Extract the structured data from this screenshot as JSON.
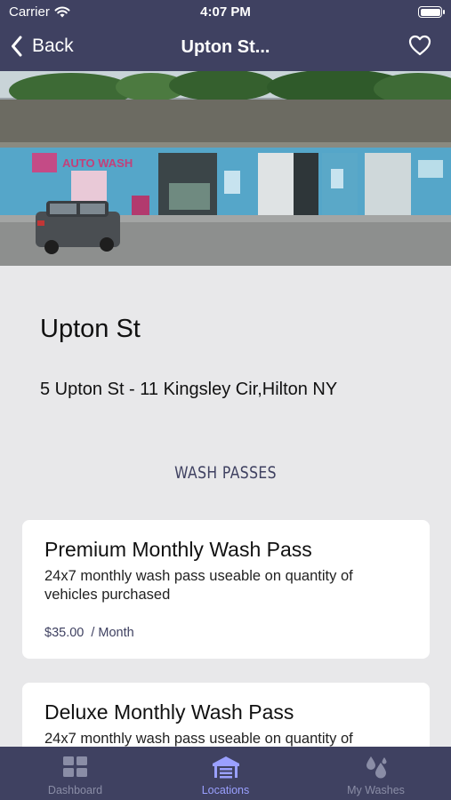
{
  "status_bar": {
    "carrier": "Carrier",
    "time": "4:07 PM"
  },
  "nav": {
    "back_label": "Back",
    "title": "Upton St...",
    "favorite_icon": "heart-outline-icon"
  },
  "location": {
    "name": "Upton St",
    "address": "5 Upton St - 11 Kingsley Cir,Hilton NY",
    "sign_text": "AUTO WASH"
  },
  "section_title": "WASH PASSES",
  "passes": [
    {
      "name": "Premium Monthly Wash Pass",
      "description": "24x7 monthly wash pass useable on quantity of vehicles purchased",
      "price": "$35.00",
      "period": "/ Month"
    },
    {
      "name": "Deluxe Monthly Wash Pass",
      "description": "24x7 monthly wash pass useable on quantity of"
    }
  ],
  "tabs": [
    {
      "label": "Dashboard",
      "icon": "grid-icon",
      "active": false
    },
    {
      "label": "Locations",
      "icon": "garage-icon",
      "active": true
    },
    {
      "label": "My Washes",
      "icon": "water-drops-icon",
      "active": false
    }
  ],
  "colors": {
    "nav_bg": "#3f4161",
    "page_bg": "#e8e8ea",
    "active_tab": "#9aa0ff",
    "inactive_tab": "#8a8da6"
  }
}
